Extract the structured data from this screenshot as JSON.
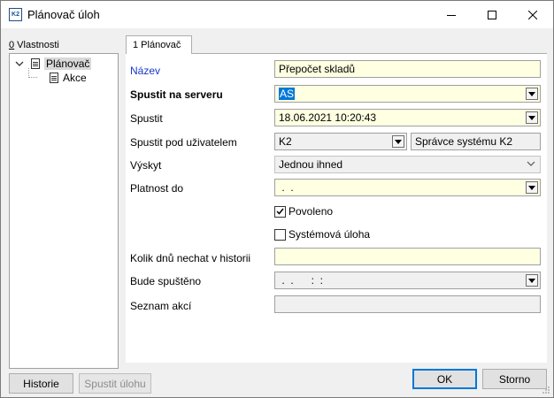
{
  "window": {
    "title": "Plánovač úloh",
    "app_icon_text": "K2"
  },
  "left": {
    "header_prefix": "0",
    "header_rest": " Vlastnosti",
    "tree": [
      {
        "label": "Plánovač",
        "selected": true
      },
      {
        "label": "Akce",
        "selected": false
      }
    ]
  },
  "tab": {
    "label": "1 Plánovač"
  },
  "form": {
    "nazev": {
      "label": "Název",
      "value": "Přepočet skladů"
    },
    "spustit_na_serveru": {
      "label": "Spustit na serveru",
      "value": "AS"
    },
    "spustit": {
      "label": "Spustit",
      "value": "18.06.2021 10:20:43"
    },
    "spustit_pod_uzivatelem": {
      "label": "Spustit pod uživatelem",
      "value": "K2",
      "user_name": "Správce systému K2"
    },
    "vyskyt": {
      "label": "Výskyt",
      "value": "Jednou ihned"
    },
    "platnost_do": {
      "label": "Platnost do",
      "value": " .  ."
    },
    "povoleno": {
      "label": "Povoleno",
      "checked": true
    },
    "systemova_uloha": {
      "label": "Systémová úloha",
      "checked": false
    },
    "kolik_dnu": {
      "label": "Kolik dnů nechat v historii",
      "value": ""
    },
    "bude_spusteno": {
      "label": "Bude spuštěno",
      "value": " .  .      :  :"
    },
    "seznam_akci": {
      "label": "Seznam akcí",
      "value": ""
    }
  },
  "buttons": {
    "historie": "Historie",
    "spustit_ulohu": "Spustit úlohu",
    "ok": "OK",
    "storno": "Storno"
  }
}
